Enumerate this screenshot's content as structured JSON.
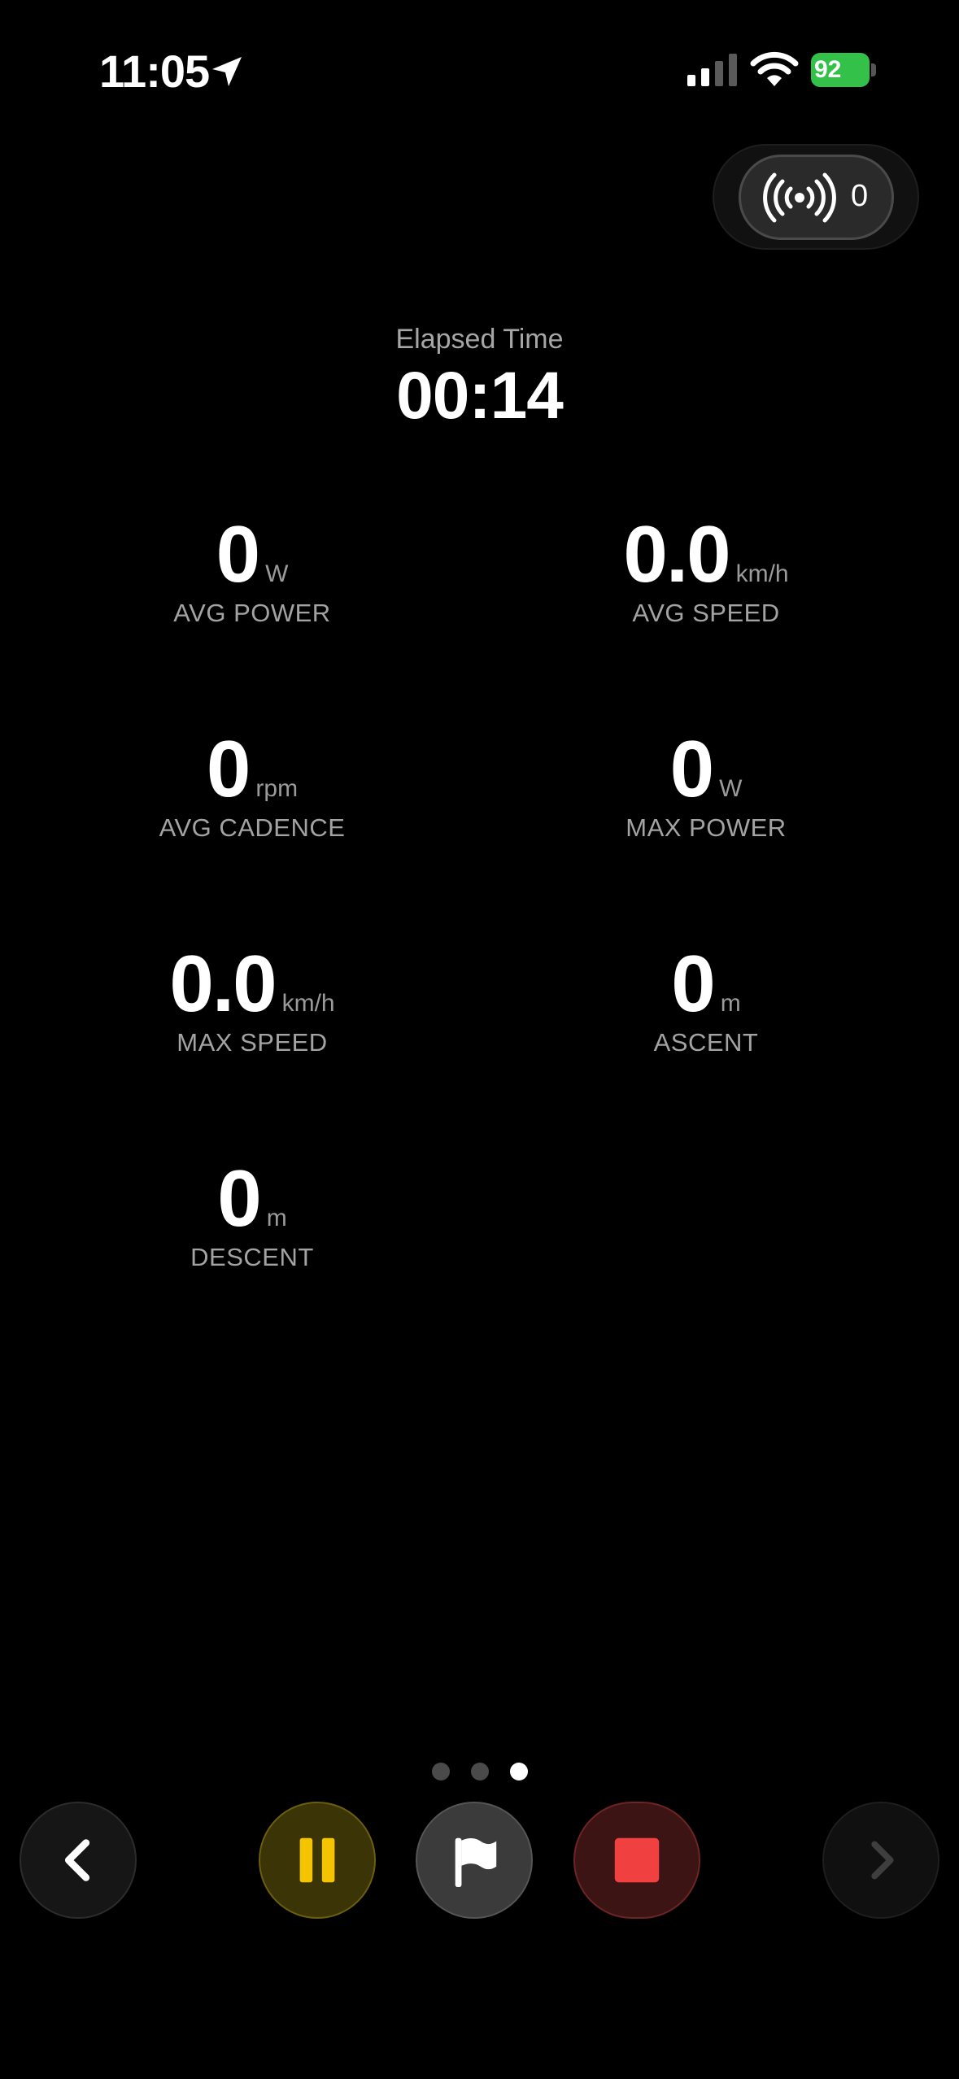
{
  "status_bar": {
    "time": "11:05",
    "battery": "92"
  },
  "sensors": {
    "count": "0"
  },
  "elapsed": {
    "label": "Elapsed Time",
    "value": "00:14"
  },
  "metrics": [
    {
      "value": "0",
      "unit": "W",
      "label": "AVG POWER"
    },
    {
      "value": "0.0",
      "unit": "km/h",
      "label": "AVG SPEED"
    },
    {
      "value": "0",
      "unit": "rpm",
      "label": "AVG CADENCE"
    },
    {
      "value": "0",
      "unit": "W",
      "label": "MAX POWER"
    },
    {
      "value": "0.0",
      "unit": "km/h",
      "label": "MAX SPEED"
    },
    {
      "value": "0",
      "unit": "m",
      "label": "ASCENT"
    },
    {
      "value": "0",
      "unit": "m",
      "label": "DESCENT"
    }
  ],
  "pager": {
    "total": 3,
    "active_index": 2
  },
  "controls": {
    "icons": [
      "chevron-left-icon",
      "pause-icon",
      "flag-icon",
      "stop-icon",
      "chevron-right-icon"
    ],
    "colors": {
      "pause": "#F5C400",
      "stop": "#F04040",
      "battery": "#33C14A"
    }
  }
}
